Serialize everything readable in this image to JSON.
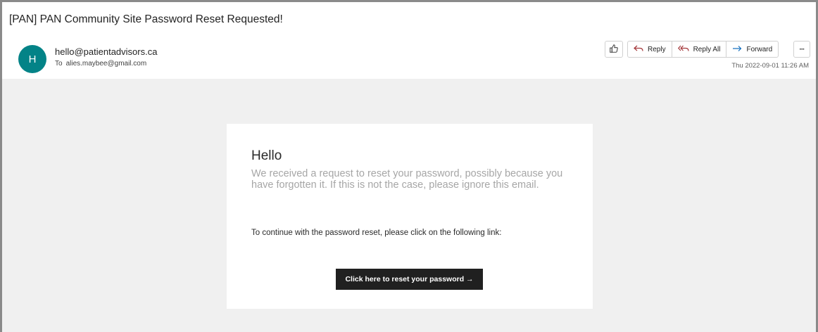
{
  "email": {
    "subject": "[PAN] PAN Community Site Password Reset Requested!",
    "avatar_initial": "H",
    "sender": "hello@patientadvisors.ca",
    "to_label": "To",
    "to_address": "alies.maybee@gmail.com",
    "timestamp": "Thu 2022-09-01 11:26 AM"
  },
  "toolbar": {
    "like_icon": "thumbs-up-icon",
    "reply_label": "Reply",
    "reply_all_label": "Reply All",
    "forward_label": "Forward",
    "more_label": "···",
    "accent_reply": "#a4373a",
    "accent_forward": "#0f6cbd"
  },
  "message": {
    "greeting": "Hello",
    "intro": "We received a request to reset your password, possibly because you have forgotten it. If this is not the case, please ignore this email.",
    "instruction": "To continue with the password reset, please click on the following link:",
    "button_label": "Click here to reset your password →"
  },
  "colors": {
    "avatar_bg": "#038387",
    "button_bg": "#202020",
    "body_bg": "#f0f0f0"
  }
}
